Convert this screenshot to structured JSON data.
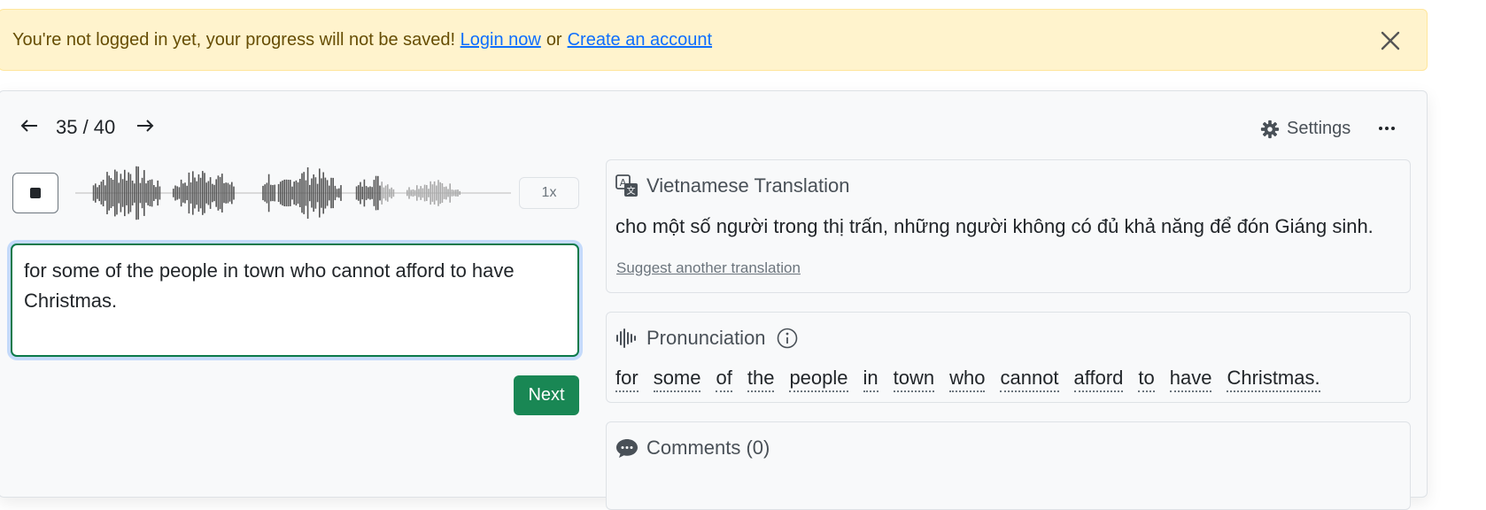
{
  "alert": {
    "message": "You're not logged in yet, your progress will not be saved!",
    "login_link": "Login now",
    "or_text": "or",
    "create_link": "Create an account"
  },
  "nav": {
    "prev_icon": "arrow-left-icon",
    "next_icon": "arrow-right-icon",
    "counter": "35 / 40"
  },
  "toolbar": {
    "settings_label": "Settings",
    "settings_icon": "gear-icon",
    "more_icon": "ellipsis-icon"
  },
  "player": {
    "stop_icon": "stop-icon",
    "speed_label": "1x",
    "progress_fraction": 0.7
  },
  "answer": {
    "value": "for some of the people in town who cannot afford to have Christmas."
  },
  "next_button_label": "Next",
  "translation": {
    "title": "Vietnamese Translation",
    "icon": "translate-icon",
    "text": "cho một số người trong thị trấn, những người không có đủ khả năng để đón Giáng sinh.",
    "suggest_link": "Suggest another translation"
  },
  "pronunciation": {
    "title": "Pronunciation",
    "icon": "audio-waveform-icon",
    "info_icon": "info-icon",
    "words": [
      "for",
      "some",
      "of",
      "the",
      "people",
      "in",
      "town",
      "who",
      "cannot",
      "afford",
      "to",
      "have",
      "Christmas."
    ]
  },
  "comments": {
    "title": "Comments (0)",
    "icon": "chat-bubble-icon"
  },
  "colors": {
    "alert_bg": "#fff3cd",
    "link": "#0d6efd",
    "primary_green": "#198754",
    "waveform_played": "#555555",
    "waveform_unplayed": "#a9a9a9"
  }
}
